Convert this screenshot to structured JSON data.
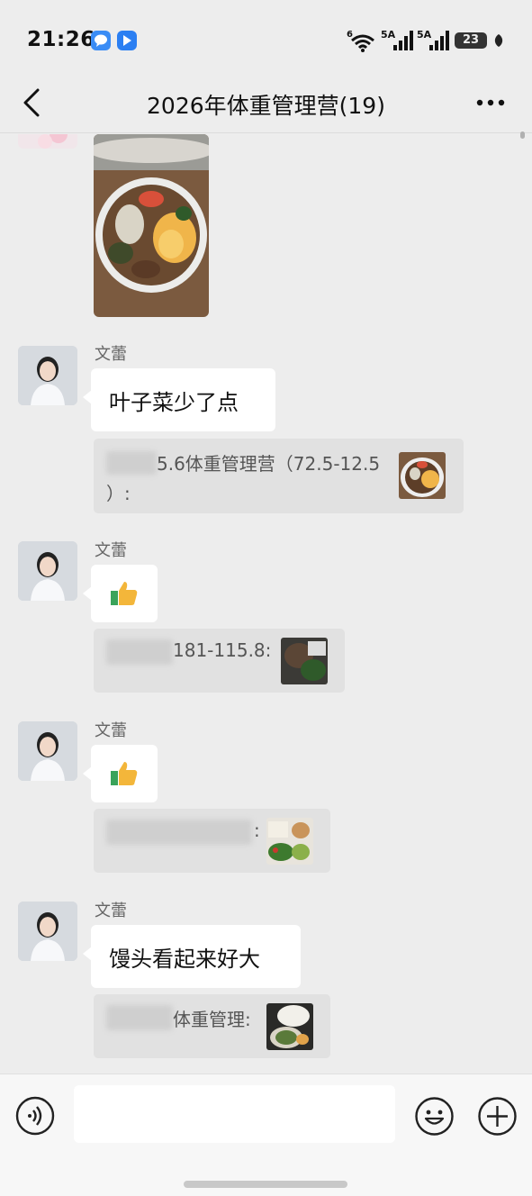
{
  "status_bar": {
    "time": "21:26",
    "battery": "23",
    "signal_label_1": "5A",
    "signal_label_2": "5A",
    "wifi_label": "6"
  },
  "nav": {
    "title": "2026年体重管理营(19)"
  },
  "messages": [
    {
      "sender": "文蕾",
      "text": "叶子菜少了点",
      "quote": "5.6体重管理营（72.5-12.5",
      "quote_line2": "）:"
    },
    {
      "sender": "文蕾",
      "sticker": "thumbs-up",
      "quote": "181-115.8:"
    },
    {
      "sender": "文蕾",
      "sticker": "thumbs-up",
      "quote": ":"
    },
    {
      "sender": "文蕾",
      "text": "馒头看起来好大",
      "quote": "体重管理:"
    }
  ],
  "colors": {
    "background": "#ededed",
    "bubble": "#ffffff",
    "quote_bg": "#e1e1e1"
  }
}
